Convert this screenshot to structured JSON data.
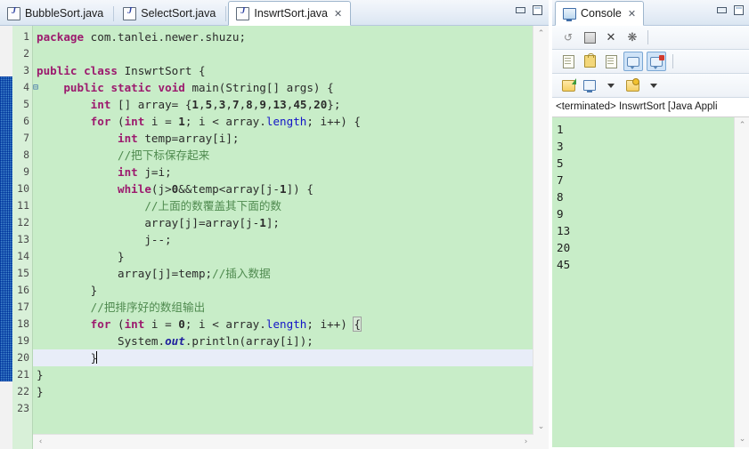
{
  "editor": {
    "tabs": [
      {
        "label": "BubbleSort.java",
        "icon": "java-file-icon",
        "active": false,
        "closable": false
      },
      {
        "label": "SelectSort.java",
        "icon": "java-file-icon",
        "active": false,
        "closable": false
      },
      {
        "label": "InswrtSort.java",
        "icon": "java-file-icon",
        "active": true,
        "closable": true
      }
    ],
    "close_glyph": "✕",
    "view_buttons": {
      "minimize": "Minimize",
      "maximize": "Maximize"
    },
    "current_line": 20,
    "fold_marker_line": 4,
    "fold_glyph": "⊟",
    "lines": [
      {
        "n": 1,
        "text": "package com.tanlei.newer.shuzu;"
      },
      {
        "n": 2,
        "text": ""
      },
      {
        "n": 3,
        "text": "public class InswrtSort {"
      },
      {
        "n": 4,
        "text": "    public static void main(String[] args) {"
      },
      {
        "n": 5,
        "text": "        int [] array= {1,5,3,7,8,9,13,45,20};"
      },
      {
        "n": 6,
        "text": "        for (int i = 1; i < array.length; i++) {"
      },
      {
        "n": 7,
        "text": "            int temp=array[i];"
      },
      {
        "n": 8,
        "text": "            //把下标保存起来"
      },
      {
        "n": 9,
        "text": "            int j=i;"
      },
      {
        "n": 10,
        "text": "            while(j>0&&temp<array[j-1]) {"
      },
      {
        "n": 11,
        "text": "                //上面的数覆盖其下面的数"
      },
      {
        "n": 12,
        "text": "                array[j]=array[j-1];"
      },
      {
        "n": 13,
        "text": "                j--;"
      },
      {
        "n": 14,
        "text": "            }"
      },
      {
        "n": 15,
        "text": "            array[j]=temp;//插入数据"
      },
      {
        "n": 16,
        "text": "        }"
      },
      {
        "n": 17,
        "text": "        //把排序好的数组输出"
      },
      {
        "n": 18,
        "text": "        for (int i = 0; i < array.length; i++) {"
      },
      {
        "n": 19,
        "text": "            System.out.println(array[i]);"
      },
      {
        "n": 20,
        "text": "        }"
      },
      {
        "n": 21,
        "text": "}"
      },
      {
        "n": 22,
        "text": "}"
      },
      {
        "n": 23,
        "text": ""
      }
    ]
  },
  "console": {
    "tab_label": "Console",
    "tab_icon": "console-icon",
    "close_glyph": "✕",
    "launch_status": "<terminated> InswrtSort [Java Appli",
    "output_lines": [
      "1",
      "3",
      "5",
      "7",
      "8",
      "9",
      "13",
      "20",
      "45"
    ],
    "toolbar_row1": [
      {
        "name": "terminate-and-relaunch-icon",
        "glyph": "link"
      },
      {
        "name": "terminate-icon",
        "glyph": "square"
      },
      {
        "name": "remove-launch-icon",
        "glyph": "x"
      },
      {
        "name": "remove-all-terminated-icon",
        "glyph": "xx"
      }
    ],
    "toolbar_row2": [
      {
        "name": "clear-console-icon",
        "glyph": "doc-x"
      },
      {
        "name": "scroll-lock-icon",
        "glyph": "lock"
      },
      {
        "name": "word-wrap-icon",
        "glyph": "doc-wrap"
      },
      {
        "name": "show-console-on-output-icon",
        "glyph": "bubble",
        "toggled": true
      },
      {
        "name": "show-console-on-error-icon",
        "glyph": "bubble-error",
        "toggled": true
      }
    ],
    "toolbar_row3": [
      {
        "name": "pin-console-icon",
        "glyph": "folder-green"
      },
      {
        "name": "display-selected-console-icon",
        "glyph": "screen"
      },
      {
        "name": "display-selected-console-dropdown-icon",
        "glyph": "caret-down"
      },
      {
        "name": "open-console-icon",
        "glyph": "folder-star"
      },
      {
        "name": "open-console-dropdown-icon",
        "glyph": "caret-down"
      }
    ]
  },
  "colors": {
    "code_background": "#c8edc8",
    "keyword": "#9c1a6e",
    "comment": "#4f8a4f",
    "field": "#1414c8",
    "static_field": "#1f1f9e",
    "current_line_highlight": "#e8edf8",
    "change_marker": "#1f6fc4",
    "tab_bar": "#e7eef7"
  },
  "scrollbars": {
    "up_arrow": "⌃",
    "down_arrow": "⌄",
    "left_arrow": "‹",
    "right_arrow": "›"
  }
}
